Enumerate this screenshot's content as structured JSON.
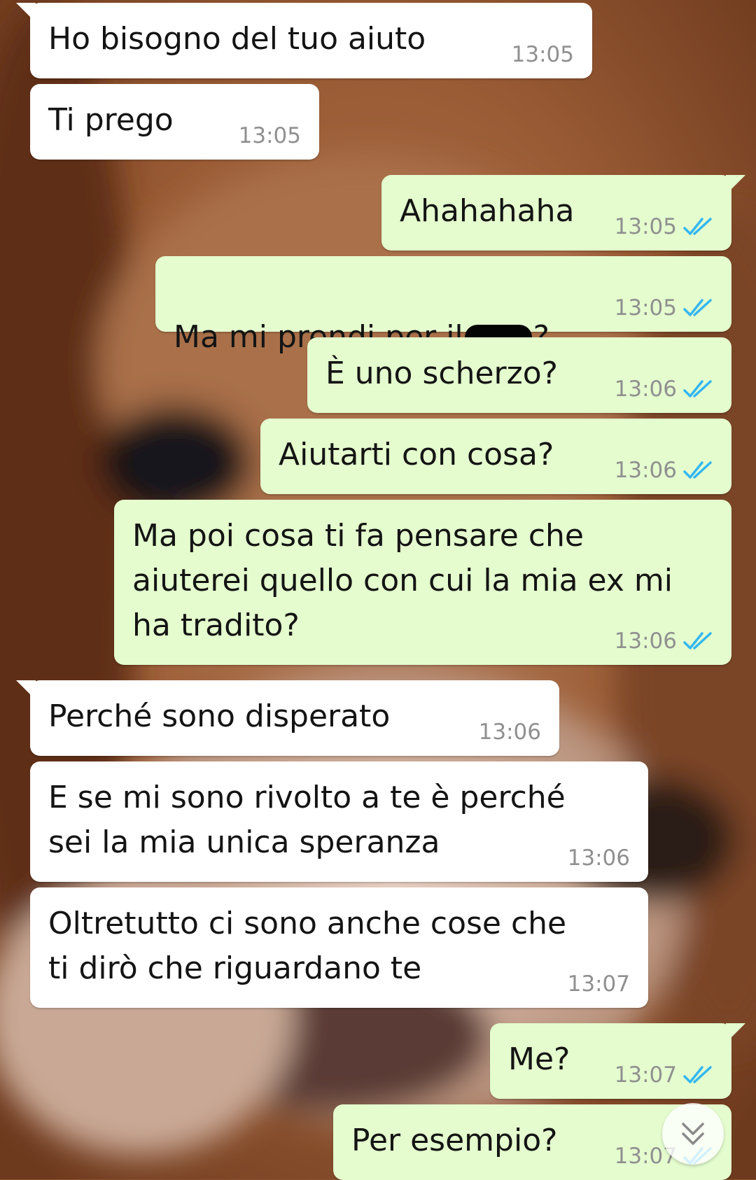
{
  "colors": {
    "incoming_bubble": "#ffffff",
    "outgoing_bubble": "#e4fcce",
    "timestamp": "#909090",
    "read_ticks": "#34b7f1"
  },
  "messages": [
    {
      "direction": "in",
      "text": "Ho bisogno del tuo aiuto",
      "time": "13:05"
    },
    {
      "direction": "in",
      "text": "Ti prego",
      "time": "13:05"
    },
    {
      "direction": "out",
      "text": "Ahahahaha",
      "time": "13:05",
      "status": "read-double-tick-icon"
    },
    {
      "direction": "out",
      "text_before": "Ma mi prendi per il",
      "text_after": "?",
      "redacted": true,
      "time": "13:05",
      "status": "read-double-tick-icon"
    },
    {
      "direction": "out",
      "text": "È uno scherzo?",
      "time": "13:06",
      "status": "read-double-tick-icon"
    },
    {
      "direction": "out",
      "text": "Aiutarti con cosa?",
      "time": "13:06",
      "status": "read-double-tick-icon"
    },
    {
      "direction": "out",
      "text": "Ma poi cosa ti fa pensare che\naiuterei quello con cui la mia ex mi\nha tradito?",
      "time": "13:06",
      "status": "read-double-tick-icon"
    },
    {
      "direction": "in",
      "text": "Perché sono disperato",
      "time": "13:06"
    },
    {
      "direction": "in",
      "text": "E se mi sono rivolto a te è perché\nsei la mia unica speranza",
      "time": "13:06"
    },
    {
      "direction": "in",
      "text": "Oltretutto ci sono anche cose che\nti dirò che riguardano te",
      "time": "13:07"
    },
    {
      "direction": "out",
      "text": "Me?",
      "time": "13:07",
      "status": "read-double-tick-icon"
    },
    {
      "direction": "out",
      "text": "Per esempio?",
      "time": "13:07",
      "status": "read-double-tick-icon"
    }
  ],
  "scroll_button_icon": "double-chevron-down-icon"
}
